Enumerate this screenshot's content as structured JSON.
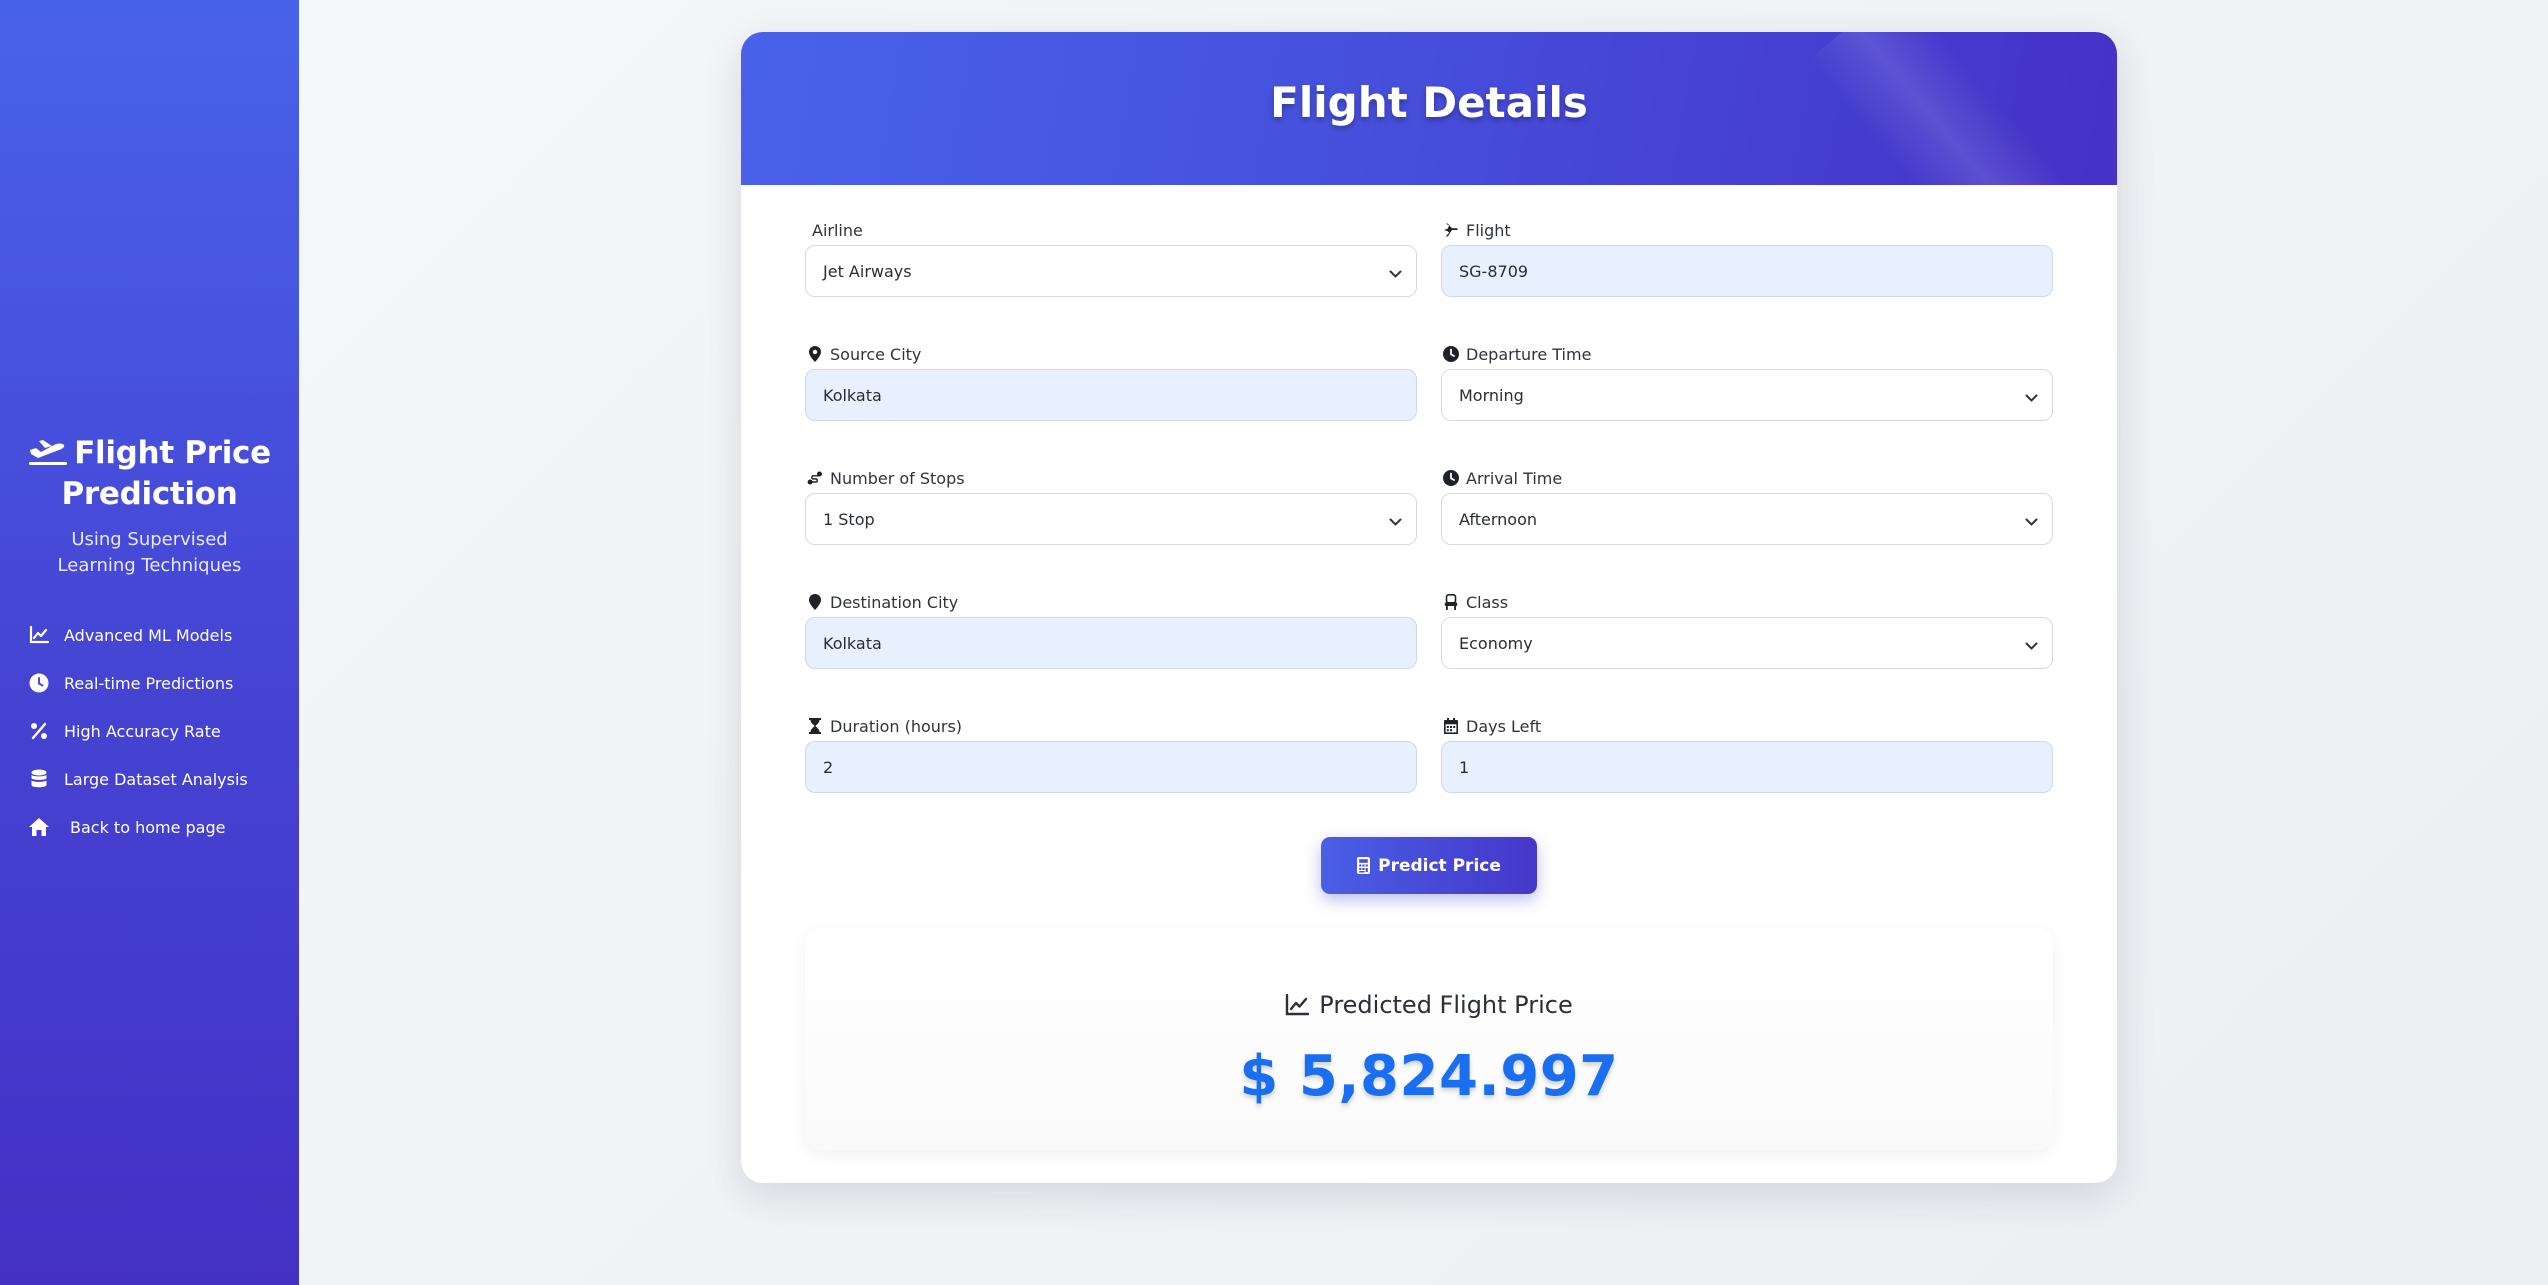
{
  "sidebar": {
    "title": "Flight Price Prediction",
    "subtitle": "Using Supervised Learning Techniques",
    "items": [
      {
        "label": "Advanced ML Models",
        "icon": "chart-line-icon"
      },
      {
        "label": "Real-time Predictions",
        "icon": "clock-icon"
      },
      {
        "label": "High Accuracy Rate",
        "icon": "percent-icon"
      },
      {
        "label": "Large Dataset Analysis",
        "icon": "database-icon"
      },
      {
        "label": "Back to home page",
        "icon": "home-icon"
      }
    ]
  },
  "form": {
    "title": "Flight Details",
    "airline": {
      "label": "Airline",
      "value": "Jet Airways"
    },
    "flight": {
      "label": "Flight",
      "value": "SG-8709"
    },
    "source_city": {
      "label": "Source City",
      "value": "Kolkata"
    },
    "departure_time": {
      "label": "Departure Time",
      "value": "Morning"
    },
    "stops": {
      "label": "Number of Stops",
      "value": "1 Stop"
    },
    "arrival_time": {
      "label": "Arrival Time",
      "value": "Afternoon"
    },
    "destination_city": {
      "label": "Destination City",
      "value": "Kolkata"
    },
    "class": {
      "label": "Class",
      "value": "Economy"
    },
    "duration": {
      "label": "Duration (hours)",
      "value": "2"
    },
    "days_left": {
      "label": "Days Left",
      "value": "1"
    },
    "submit_label": "Predict Price"
  },
  "result": {
    "title": "Predicted Flight Price",
    "value": "$ 5,824.997"
  },
  "colors": {
    "primary": "#4a5fe6",
    "primary_dark": "#4431c4",
    "price": "#1a6ff0",
    "input_fill": "#e8f0fe"
  }
}
